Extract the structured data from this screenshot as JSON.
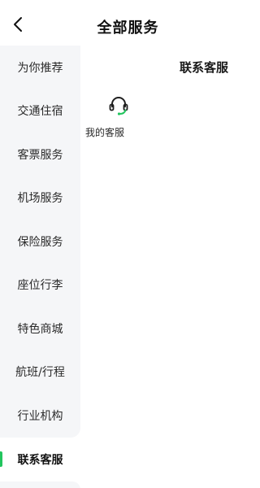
{
  "header": {
    "title": "全部服务",
    "back_icon": "chevron-left-icon"
  },
  "sidebar": {
    "accent_color": "#22c55e",
    "items": [
      {
        "label": "为你推荐"
      },
      {
        "label": "交通住宿"
      },
      {
        "label": "客票服务"
      },
      {
        "label": "机场服务"
      },
      {
        "label": "保险服务"
      },
      {
        "label": "座位行李"
      },
      {
        "label": "特色商城"
      },
      {
        "label": "航班/行程"
      },
      {
        "label": "行业机构"
      },
      {
        "label": "联系客服",
        "active": true
      }
    ]
  },
  "main": {
    "section_title": "联系客服",
    "services": [
      {
        "label": "我的客服",
        "icon": "headset-icon"
      }
    ]
  }
}
